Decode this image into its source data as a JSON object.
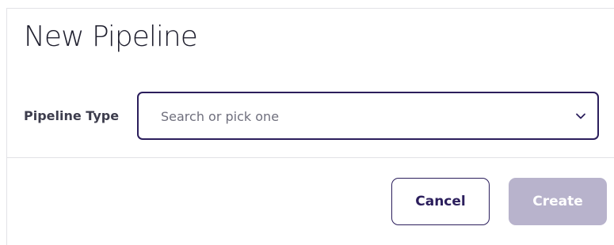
{
  "dialog": {
    "title": "New Pipeline",
    "pipeline_type": {
      "label": "Pipeline Type",
      "placeholder": "Search or pick one",
      "value": ""
    },
    "buttons": {
      "cancel_label": "Cancel",
      "create_label": "Create",
      "create_enabled": false
    }
  },
  "colors": {
    "accent": "#2b1e5c",
    "create_disabled_bg": "#b8b3cc",
    "divider": "#e2e2e6"
  }
}
